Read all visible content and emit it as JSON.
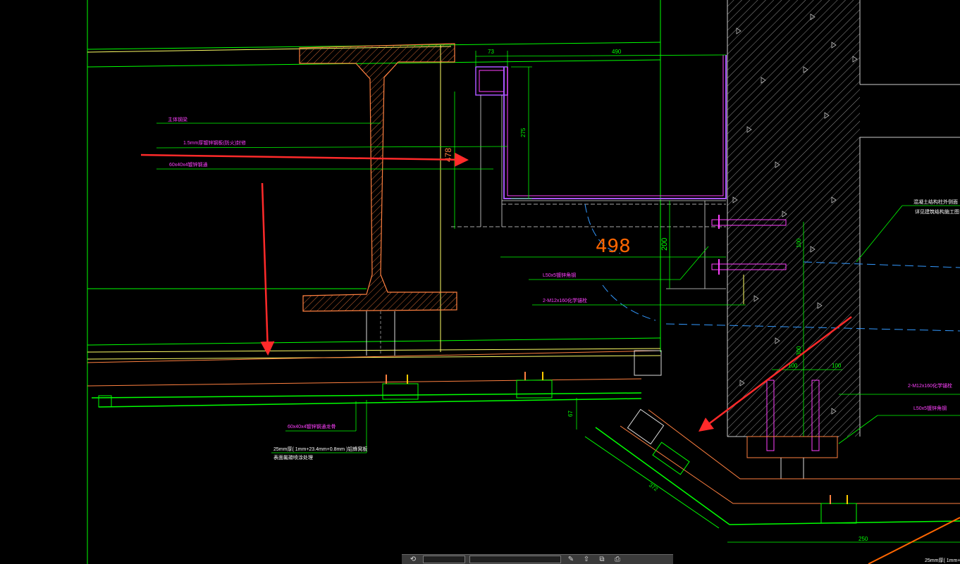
{
  "drawing": {
    "dimensions": {
      "d73": "73",
      "d490": "490",
      "d275": "275",
      "d478": "478",
      "d498": "498",
      "d200": "200",
      "d100_right": "100",
      "d100_b1": "100",
      "d100_b2": "100",
      "d300": "300",
      "d67": "67",
      "d372": "372",
      "d250": "250"
    },
    "labels": {
      "lbl1": "主体钢梁",
      "lbl2": "1.5mm厚镀锌钢板(防火)封修",
      "lbl3": "60x40x4镀锌钢通",
      "lbl4": "L50x5镀锌角钢",
      "lbl5": "2-M12x160化学锚栓",
      "lbl6": "60x40x4镀锌钢通龙骨",
      "lbl7": "25mm厚(    1mm+23.4mm+0.8mm )铝蜂窝板",
      "lbl8": "表面氟碳喷涂处理",
      "lbl9": "混凝土结构柱外侧面",
      "lbl10": "详见建筑结构施工图",
      "lbl11": "2-M12x160化学锚栓",
      "lbl12": "L50x5镀锌角钢",
      "lbl13": "25mm厚(    1mm+"
    },
    "colors": {
      "background": "#000000",
      "green": "#00ff00",
      "yellow": "#ffff66",
      "orange": "#ff8040",
      "magenta": "#ff40ff",
      "blue": "#3399ff",
      "white": "#ffffff",
      "annotation_red": "#ff2a2a"
    }
  },
  "toolbar": {
    "icons": [
      "undo-icon",
      "model-field",
      "layout-field",
      "pen-icon",
      "arrow-up-icon",
      "copy-icon",
      "print-icon"
    ],
    "undo_glyph": "⟲",
    "pen_glyph": "✎",
    "arrow_glyph": "⇧",
    "copy_glyph": "⧉",
    "print_glyph": "⎙"
  }
}
